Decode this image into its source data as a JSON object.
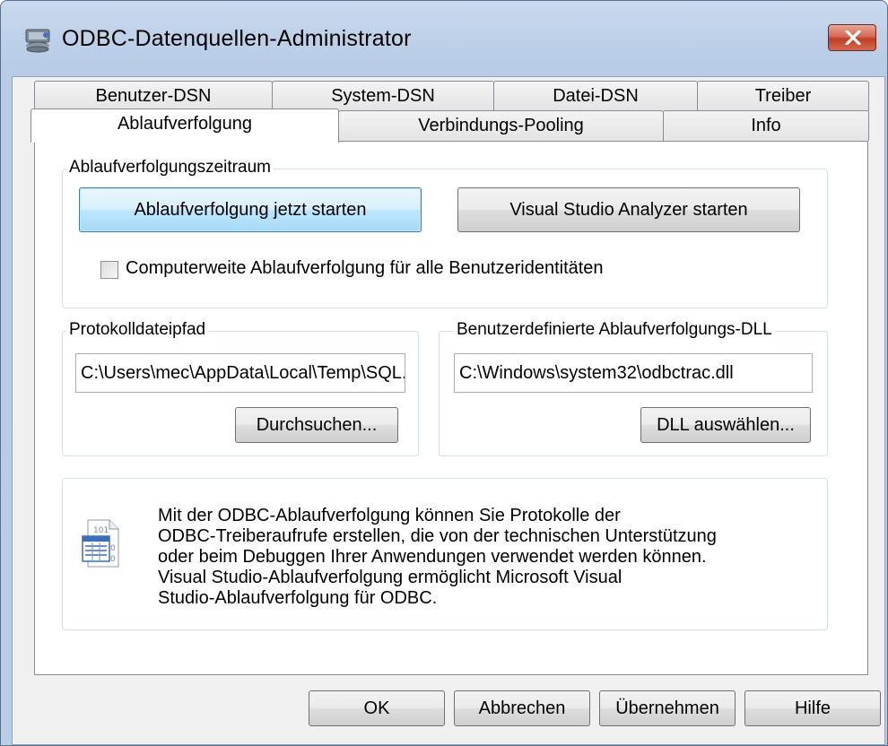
{
  "window": {
    "title": "ODBC-Datenquellen-Administrator"
  },
  "tabs_back": [
    "Benutzer-DSN",
    "System-DSN",
    "Datei-DSN",
    "Treiber"
  ],
  "tabs_front": [
    "Ablaufverfolgung",
    "Verbindungs-Pooling",
    "Info"
  ],
  "active_tab": "Ablaufverfolgung",
  "tracing": {
    "group_label": "Ablaufverfolgungszeitraum",
    "start_button": "Ablaufverfolgung jetzt starten",
    "vs_analyzer_button": "Visual Studio Analyzer starten",
    "machine_wide_checkbox": {
      "label": "Computerweite Ablaufverfolgung für alle Benutzeridentitäten",
      "checked": false
    }
  },
  "logfile": {
    "group_label": "Protokolldateipfad",
    "value": "C:\\Users\\mec\\AppData\\Local\\Temp\\SQL.LOG",
    "browse_button": "Durchsuchen..."
  },
  "custom_dll": {
    "group_label": "Benutzerdefinierte Ablaufverfolgungs-DLL",
    "value": "C:\\Windows\\system32\\odbctrac.dll",
    "select_button": "DLL auswählen..."
  },
  "info": {
    "lines": [
      "Mit der ODBC-Ablaufverfolgung können Sie Protokolle der",
      "ODBC-Treiberaufrufe erstellen, die von der technischen Unterstützung",
      "oder beim Debuggen Ihrer Anwendungen verwendet werden können.",
      "Visual Studio-Ablaufverfolgung ermöglicht Microsoft Visual",
      "Studio-Ablaufverfolgung für ODBC."
    ]
  },
  "footer": {
    "ok": "OK",
    "cancel": "Abbrechen",
    "apply": "Übernehmen",
    "help": "Hilfe"
  },
  "icons": {
    "app": "odbc-admin-icon",
    "close": "close-icon",
    "info": "trace-log-icon"
  },
  "colors": {
    "title_bar": "#b9cde6",
    "close_button": "#c13d25",
    "default_button_border": "#3c7fb1"
  }
}
